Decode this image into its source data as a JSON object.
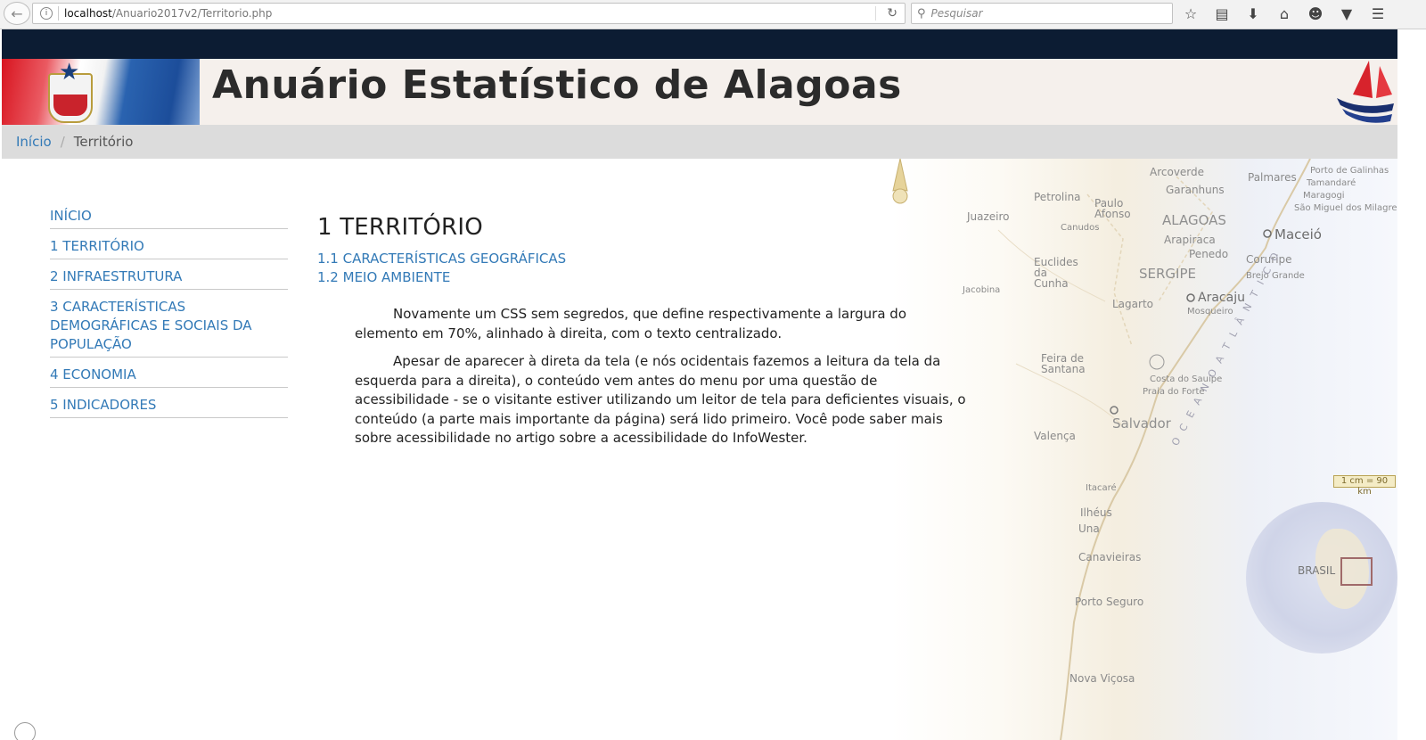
{
  "browser": {
    "url_host": "localhost",
    "url_path": "/Anuario2017v2/Territorio.php",
    "search_placeholder": "Pesquisar"
  },
  "header": {
    "title": "Anuário Estatístico de Alagoas"
  },
  "breadcrumb": {
    "home": "Início",
    "separator": "/",
    "current": "Território"
  },
  "sidebar": {
    "items": [
      {
        "label": "INÍCIO"
      },
      {
        "label": "1 TERRITÓRIO"
      },
      {
        "label": "2 INFRAESTRUTURA"
      },
      {
        "label": "3 CARACTERÍSTICAS DEMOGRÁFICAS E SOCIAIS DA POPULAÇÃO"
      },
      {
        "label": "4 ECONOMIA"
      },
      {
        "label": "5 INDICADORES"
      }
    ]
  },
  "main": {
    "title": "1 TERRITÓRIO",
    "links": [
      {
        "label": "1.1 CARACTERÍSTICAS GEOGRÁFICAS"
      },
      {
        "label": "1.2 MEIO AMBIENTE"
      }
    ],
    "paragraphs": [
      "Novamente um CSS sem segredos, que define respectivamente a largura do elemento em 70%, alinhado à direita, com o texto centralizado.",
      "Apesar de aparecer à direta da tela (e nós ocidentais fazemos a leitura da tela da esquerda para a direita), o conteúdo vem antes do menu por uma questão de acessibilidade - se o visitante estiver utilizando um leitor de tela para deficientes visuais, o conteúdo (a parte mais importante da página) será lido primeiro. Você pode saber mais sobre acessibilidade no artigo sobre a acessibilidade do InfoWester."
    ]
  },
  "map": {
    "labels": {
      "arcoverde": "Arcoverde",
      "palmares": "Palmares",
      "garanhuns": "Garanhuns",
      "petrolina": "Petrolina",
      "paulo_afonso": "Paulo Afonso",
      "juazeiro": "Juazeiro",
      "alagoas": "ALAGOAS",
      "maceio": "Maceió",
      "porto_galinhas": "Porto de Galinhas",
      "tamandare": "Tamandaré",
      "maragogi": "Maragogi",
      "sao_miguel": "São Miguel dos Milagres",
      "canudos": "Canudos",
      "arapiraca": "Arapiraca",
      "penedo": "Penedo",
      "coruripe": "Coruripe",
      "euclides": "Euclides da Cunha",
      "sergipe": "SERGIPE",
      "brejo_grande": "Brejo Grande",
      "aracaju": "Aracaju",
      "lagarto": "Lagarto",
      "jacobina": "Jacobina",
      "mosqueiro": "Mosqueiro",
      "feira": "Feira de Santana",
      "costa_sauipe": "Costa do Sauípe",
      "praia_forte": "Praia do Forte",
      "salvador": "Salvador",
      "valenca": "Valença",
      "itacare": "Itacaré",
      "ilheus": "Ilhéus",
      "una": "Una",
      "canavieiras": "Canavieiras",
      "porto_seguro": "Porto Seguro",
      "nova_vicosa": "Nova Viçosa",
      "scale": "1 cm = 90 km",
      "brasil": "BRASIL",
      "ocean": "O C E A N O   A T L Â N T I C O"
    }
  },
  "colors": {
    "link": "#337ab7",
    "top_band": "#0c1c33",
    "header_bg": "#f5f0ec",
    "breadcrumb_bg": "#dcdcdc"
  },
  "icons": [
    "back-arrow-icon",
    "info-icon",
    "reload-icon",
    "search-icon",
    "star-icon",
    "reading-list-icon",
    "download-icon",
    "home-icon",
    "chat-icon",
    "pocket-icon",
    "menu-icon"
  ]
}
